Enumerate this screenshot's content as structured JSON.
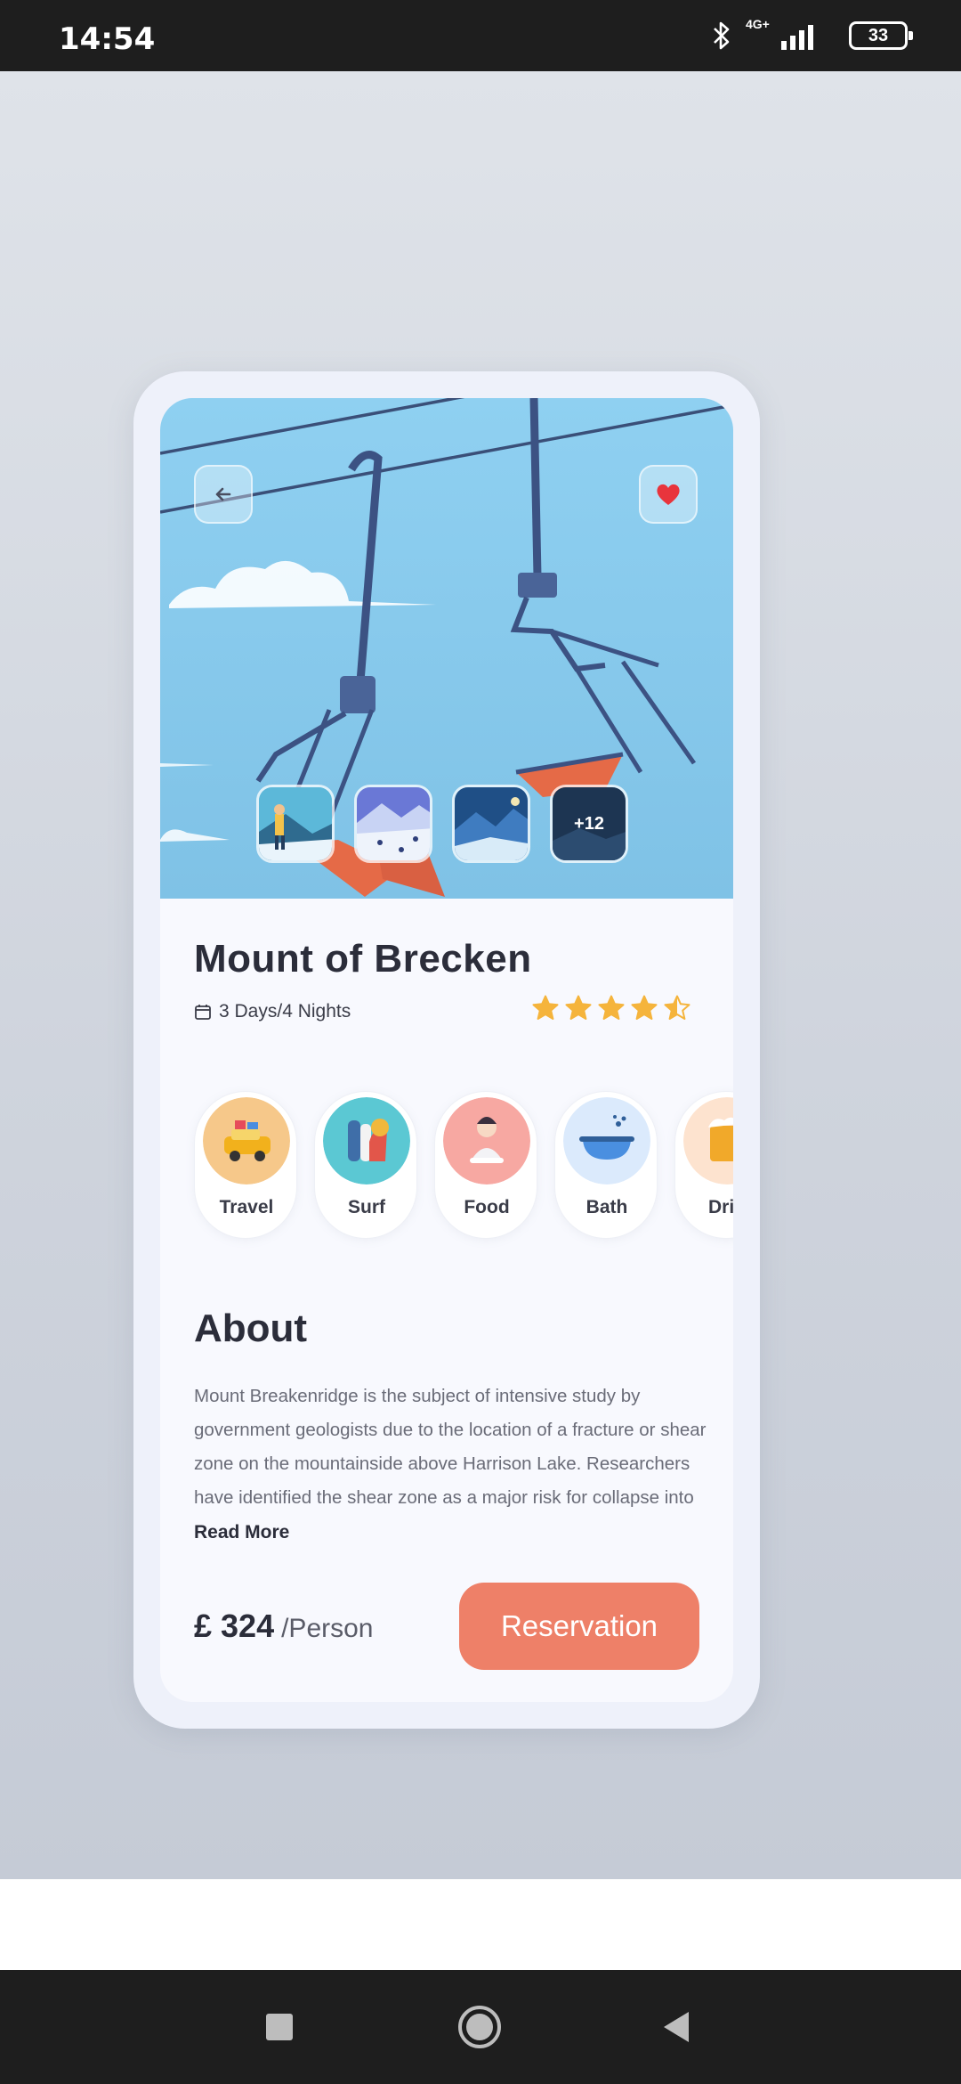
{
  "status_bar": {
    "time": "14:54",
    "network": "4G+",
    "battery": "33"
  },
  "hero": {
    "thumb_more": "+12"
  },
  "place": {
    "title": "Mount of Brecken",
    "duration": "3 Days/4 Nights",
    "rating": 4.5
  },
  "categories": [
    {
      "label": "Travel",
      "bg": "#f6c88a"
    },
    {
      "label": "Surf",
      "bg": "#5bc8d3"
    },
    {
      "label": "Food",
      "bg": "#f7a8a2"
    },
    {
      "label": "Bath",
      "bg": "#dbeafc"
    },
    {
      "label": "Drin",
      "bg": "#fde3cf"
    }
  ],
  "about": {
    "title": "About",
    "text": "Mount Breakenridge is the subject of intensive study by government geologists due to the location of a fracture or shear zone on the mountainside above Harrison Lake. Researchers have identified the shear zone as a major risk for collapse into",
    "read_more": "Read More"
  },
  "booking": {
    "price": "£ 324",
    "unit": "/Person",
    "button": "Reservation"
  },
  "colors": {
    "accent": "#ee8068",
    "star": "#f5b43c",
    "heart": "#e8343c"
  }
}
